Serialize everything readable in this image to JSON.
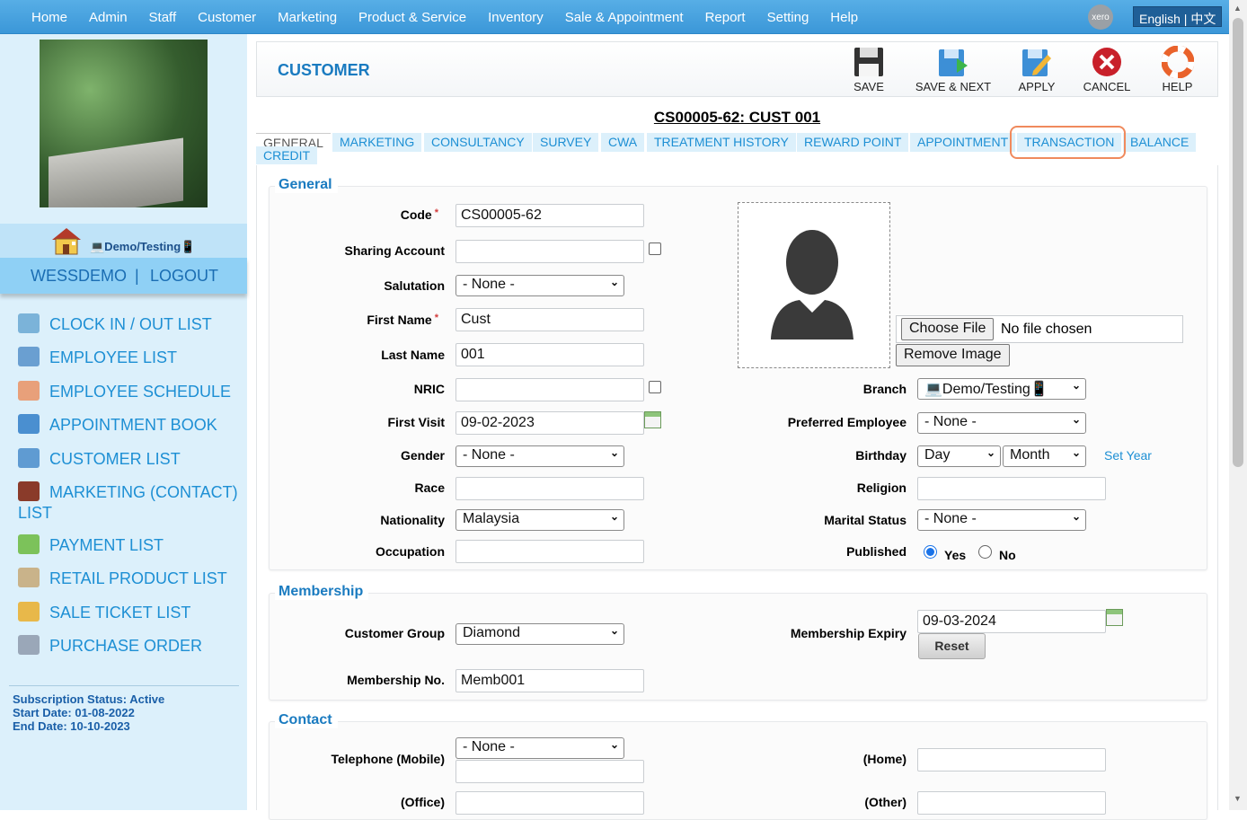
{
  "top_nav": {
    "items": [
      "Home",
      "Admin",
      "Staff",
      "Customer",
      "Marketing",
      "Product & Service",
      "Inventory",
      "Sale & Appointment",
      "Report",
      "Setting",
      "Help"
    ],
    "xero_label": "xero",
    "language": "English | 中文"
  },
  "sidebar": {
    "branch_label": "💻Demo/Testing📱",
    "username": "WESSDEMO",
    "separator": "|",
    "logout": "LOGOUT",
    "menu": [
      {
        "label": "CLOCK IN / OUT LIST",
        "icon": "clock-icon",
        "color": "#7bb3d9"
      },
      {
        "label": "EMPLOYEE LIST",
        "icon": "employee-list-icon",
        "color": "#6a9fd1"
      },
      {
        "label": "EMPLOYEE SCHEDULE",
        "icon": "calendar-icon",
        "color": "#e8a07a"
      },
      {
        "label": "APPOINTMENT BOOK",
        "icon": "appointment-icon",
        "color": "#4a8fd0"
      },
      {
        "label": "CUSTOMER LIST",
        "icon": "customer-list-icon",
        "color": "#5f9bd2"
      },
      {
        "label": "MARKETING (CONTACT) LIST",
        "icon": "marketing-book-icon",
        "color": "#8a3b2a"
      },
      {
        "label": "PAYMENT LIST",
        "icon": "payment-icon",
        "color": "#7cc25a"
      },
      {
        "label": "RETAIL PRODUCT LIST",
        "icon": "product-box-icon",
        "color": "#c9b38a"
      },
      {
        "label": "SALE TICKET LIST",
        "icon": "sale-ticket-icon",
        "color": "#e8b84a"
      },
      {
        "label": "PURCHASE ORDER",
        "icon": "purchase-order-icon",
        "color": "#9aa7b8"
      }
    ],
    "subscription_status": "Subscription Status: Active",
    "start_date": "Start Date: 01-08-2022",
    "end_date": "End Date: 10-10-2023"
  },
  "header": {
    "title": "CUSTOMER",
    "buttons": {
      "save": "SAVE",
      "save_next": "SAVE & NEXT",
      "apply": "APPLY",
      "cancel": "CANCEL",
      "help": "HELP"
    }
  },
  "record_title": "CS00005-62: CUST 001",
  "tabs": [
    "GENERAL",
    "MARKETING",
    "CONSULTANCY",
    "SURVEY",
    "CWA",
    "TREATMENT HISTORY",
    "REWARD POINT",
    "APPOINTMENT",
    "TRANSACTION",
    "BALANCE",
    "CREDIT"
  ],
  "general": {
    "title": "General",
    "code_label": "Code",
    "code": "CS00005-62",
    "sharing_label": "Sharing Account",
    "sharing": "",
    "salutation_label": "Salutation",
    "salutation": "- None -",
    "first_name_label": "First Name",
    "first_name": "Cust",
    "last_name_label": "Last Name",
    "last_name": "001",
    "nric_label": "NRIC",
    "nric": "",
    "first_visit_label": "First Visit",
    "first_visit": "09-02-2023",
    "gender_label": "Gender",
    "gender": "- None -",
    "race_label": "Race",
    "race": "",
    "nationality_label": "Nationality",
    "nationality": "Malaysia",
    "occupation_label": "Occupation",
    "occupation": "",
    "choose_file": "Choose File",
    "no_file": "No file chosen",
    "remove_image": "Remove Image",
    "branch_label": "Branch",
    "branch": "💻Demo/Testing📱",
    "preferred_label": "Preferred Employee",
    "preferred": "- None -",
    "birthday_label": "Birthday",
    "birthday_day": "Day",
    "birthday_month": "Month",
    "set_year": "Set Year",
    "religion_label": "Religion",
    "religion": "",
    "marital_label": "Marital Status",
    "marital": "- None -",
    "published_label": "Published",
    "yes": "Yes",
    "no": "No"
  },
  "membership": {
    "title": "Membership",
    "group_label": "Customer Group",
    "group": "Diamond",
    "expiry_label": "Membership Expiry",
    "expiry": "09-03-2024",
    "reset": "Reset",
    "number_label": "Membership No.",
    "number": "Memb001"
  },
  "contact": {
    "title": "Contact",
    "mobile_label": "Telephone (Mobile)",
    "mobile_prefix": "- None -",
    "mobile": "",
    "home_label": "(Home)",
    "home": "",
    "office_label": "(Office)",
    "office": "",
    "other_label": "(Other)",
    "other": ""
  }
}
